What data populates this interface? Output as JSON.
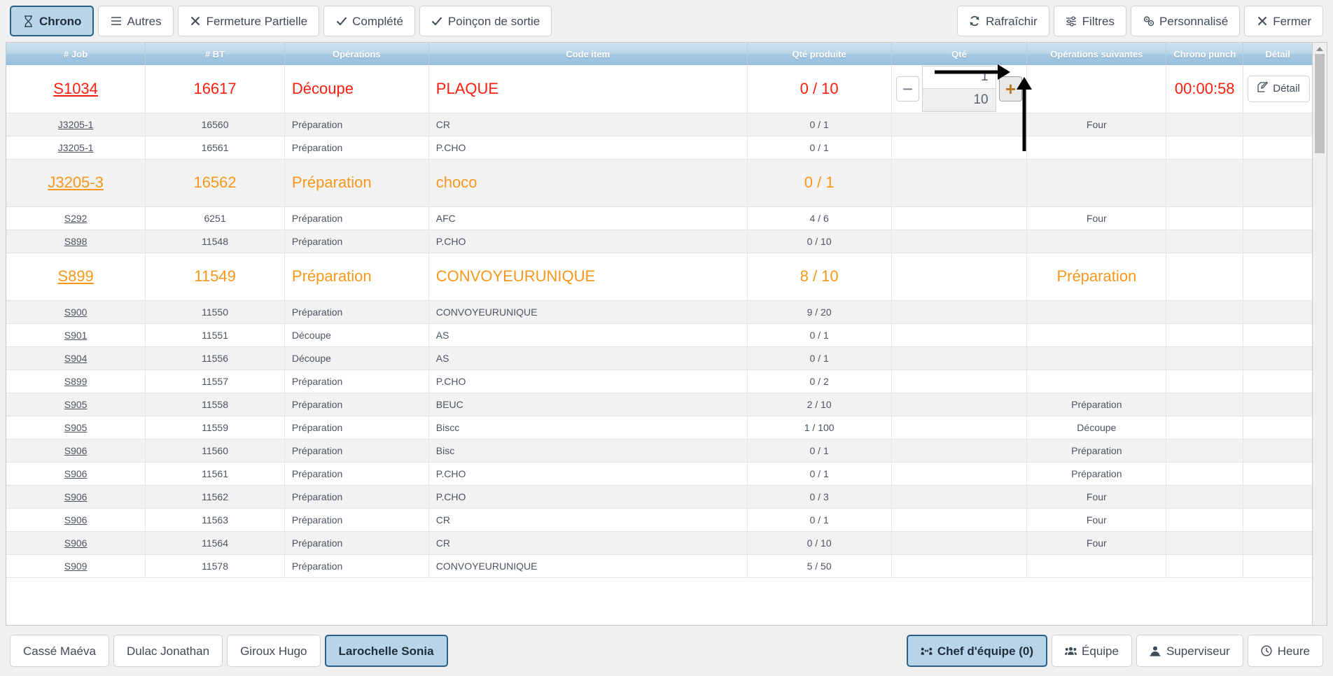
{
  "toolbar": {
    "left": [
      {
        "label": "Chrono",
        "icon": "hourglass-icon",
        "active": true
      },
      {
        "label": "Autres",
        "icon": "list-icon",
        "active": false
      },
      {
        "label": "Fermeture Partielle",
        "icon": "close-icon",
        "active": false
      },
      {
        "label": "Complété",
        "icon": "check-icon",
        "active": false
      },
      {
        "label": "Poinçon de sortie",
        "icon": "check-icon",
        "active": false
      }
    ],
    "right": [
      {
        "label": "Rafraîchir",
        "icon": "refresh-icon",
        "active": false
      },
      {
        "label": "Filtres",
        "icon": "sliders-icon",
        "active": false
      },
      {
        "label": "Personnalisé",
        "icon": "gears-icon",
        "active": false
      },
      {
        "label": "Fermer",
        "icon": "close-icon",
        "active": false
      }
    ]
  },
  "table": {
    "columns": [
      "# Job",
      "# BT",
      "Opérations",
      "Code item",
      "Qté produite",
      "Qté",
      "Opérations suivantes",
      "Chrono punch",
      "Détail"
    ],
    "rows": [
      {
        "job": "S1034",
        "bt": "16617",
        "operation": "Découpe",
        "code": "PLAQUE",
        "qte_produite": "0 / 10",
        "next_op": "",
        "chrono": "00:00:58",
        "highlight": "red",
        "stepper": true,
        "detail_label": "Détail",
        "qty_value": "1",
        "qty_total": "10",
        "minus_label": "−",
        "plus_label": "+"
      },
      {
        "job": "J3205-1",
        "bt": "16560",
        "operation": "Préparation",
        "code": "CR",
        "qte_produite": "0 / 1",
        "next_op": "Four",
        "chrono": "",
        "highlight": ""
      },
      {
        "job": "J3205-1",
        "bt": "16561",
        "operation": "Préparation",
        "code": "P.CHO",
        "qte_produite": "0 / 1",
        "next_op": "",
        "chrono": "",
        "highlight": ""
      },
      {
        "job": "J3205-3",
        "bt": "16562",
        "operation": "Préparation",
        "code": "choco",
        "qte_produite": "0 / 1",
        "next_op": "",
        "chrono": "",
        "highlight": "orange"
      },
      {
        "job": "S292",
        "bt": "6251",
        "operation": "Préparation",
        "code": "AFC",
        "qte_produite": "4 / 6",
        "next_op": "Four",
        "chrono": "",
        "highlight": ""
      },
      {
        "job": "S898",
        "bt": "11548",
        "operation": "Préparation",
        "code": "P.CHO",
        "qte_produite": "0 / 10",
        "next_op": "",
        "chrono": "",
        "highlight": ""
      },
      {
        "job": "S899",
        "bt": "11549",
        "operation": "Préparation",
        "code": "CONVOYEURUNIQUE",
        "qte_produite": "8 / 10",
        "next_op": "Préparation",
        "chrono": "",
        "highlight": "orange"
      },
      {
        "job": "S900",
        "bt": "11550",
        "operation": "Préparation",
        "code": "CONVOYEURUNIQUE",
        "qte_produite": "9 / 20",
        "next_op": "",
        "chrono": "",
        "highlight": ""
      },
      {
        "job": "S901",
        "bt": "11551",
        "operation": "Découpe",
        "code": "AS",
        "qte_produite": "0 / 1",
        "next_op": "",
        "chrono": "",
        "highlight": ""
      },
      {
        "job": "S904",
        "bt": "11556",
        "operation": "Découpe",
        "code": "AS",
        "qte_produite": "0 / 1",
        "next_op": "",
        "chrono": "",
        "highlight": ""
      },
      {
        "job": "S899",
        "bt": "11557",
        "operation": "Préparation",
        "code": "P.CHO",
        "qte_produite": "0 / 2",
        "next_op": "",
        "chrono": "",
        "highlight": ""
      },
      {
        "job": "S905",
        "bt": "11558",
        "operation": "Préparation",
        "code": "BEUC",
        "qte_produite": "2 / 10",
        "next_op": "Préparation",
        "chrono": "",
        "highlight": ""
      },
      {
        "job": "S905",
        "bt": "11559",
        "operation": "Préparation",
        "code": "Biscc",
        "qte_produite": "1 / 100",
        "next_op": "Découpe",
        "chrono": "",
        "highlight": ""
      },
      {
        "job": "S906",
        "bt": "11560",
        "operation": "Préparation",
        "code": "Bisc",
        "qte_produite": "0 / 1",
        "next_op": "Préparation",
        "chrono": "",
        "highlight": ""
      },
      {
        "job": "S906",
        "bt": "11561",
        "operation": "Préparation",
        "code": "P.CHO",
        "qte_produite": "0 / 1",
        "next_op": "Préparation",
        "chrono": "",
        "highlight": ""
      },
      {
        "job": "S906",
        "bt": "11562",
        "operation": "Préparation",
        "code": "P.CHO",
        "qte_produite": "0 / 3",
        "next_op": "Four",
        "chrono": "",
        "highlight": ""
      },
      {
        "job": "S906",
        "bt": "11563",
        "operation": "Préparation",
        "code": "CR",
        "qte_produite": "0 / 1",
        "next_op": "Four",
        "chrono": "",
        "highlight": ""
      },
      {
        "job": "S906",
        "bt": "11564",
        "operation": "Préparation",
        "code": "CR",
        "qte_produite": "0 / 10",
        "next_op": "Four",
        "chrono": "",
        "highlight": ""
      },
      {
        "job": "S909",
        "bt": "11578",
        "operation": "Préparation",
        "code": "CONVOYEURUNIQUE",
        "qte_produite": "5 / 50",
        "next_op": "",
        "chrono": "",
        "highlight": ""
      }
    ]
  },
  "bottom": {
    "employees": [
      {
        "label": "Cassé Maéva",
        "active": false
      },
      {
        "label": "Dulac Jonathan",
        "active": false
      },
      {
        "label": "Giroux Hugo",
        "active": false
      },
      {
        "label": "Larochelle Sonia",
        "active": true
      }
    ],
    "actions": [
      {
        "label": "Chef d'équipe (0)",
        "icon": "team-leader-icon",
        "active": true
      },
      {
        "label": "Équipe",
        "icon": "users-icon",
        "active": false
      },
      {
        "label": "Superviseur",
        "icon": "supervisor-icon",
        "active": false
      },
      {
        "label": "Heure",
        "icon": "clock-icon",
        "active": false
      }
    ]
  },
  "colors": {
    "red": "#fa1e0e",
    "orange": "#f8971d",
    "accent": "#b7d4e8",
    "header_blue": "#a6c9e2",
    "text": "#4a5560"
  }
}
